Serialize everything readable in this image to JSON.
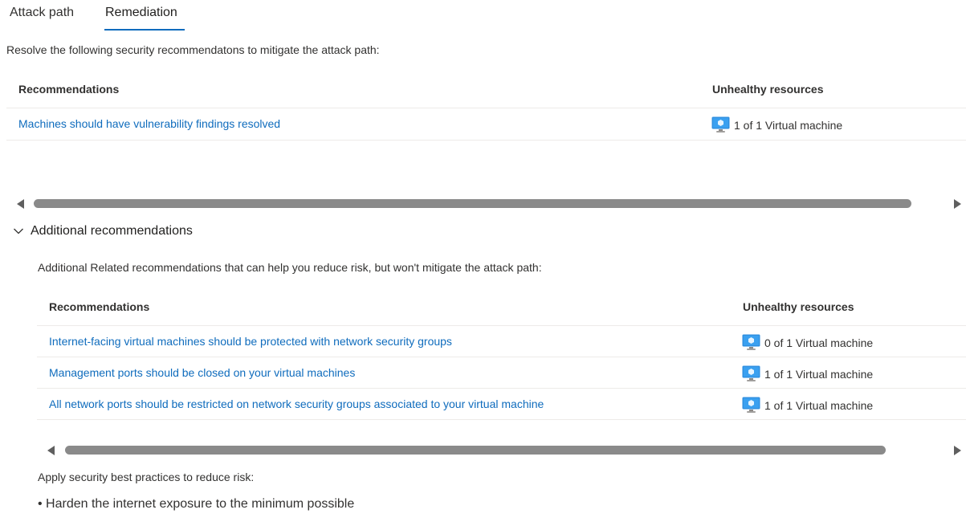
{
  "tabs": [
    {
      "label": "Attack path"
    },
    {
      "label": "Remediation"
    }
  ],
  "intro": "Resolve the following security recommendatons to mitigate the attack path:",
  "main_table": {
    "headers": {
      "recommendations": "Recommendations",
      "unhealthy": "Unhealthy resources"
    },
    "rows": [
      {
        "recommendation": "Machines should have vulnerability findings resolved",
        "unhealthy": "1 of 1 Virtual machine"
      }
    ]
  },
  "additional": {
    "title": "Additional recommendations",
    "intro": "Additional Related recommendations that can help you reduce risk, but won't mitigate the attack path:",
    "table": {
      "headers": {
        "recommendations": "Recommendations",
        "unhealthy": "Unhealthy resources"
      },
      "rows": [
        {
          "recommendation": "Internet-facing virtual machines should be protected with network security groups",
          "unhealthy": "0 of 1 Virtual machine"
        },
        {
          "recommendation": "Management ports should be closed on your virtual machines",
          "unhealthy": "1 of 1 Virtual machine"
        },
        {
          "recommendation": "All network ports should be restricted on network security groups associated to your virtual machine",
          "unhealthy": "1 of 1 Virtual machine"
        }
      ]
    }
  },
  "best_practices": {
    "label": "Apply security best practices to reduce risk:",
    "items": [
      "• Harden the internet exposure to the minimum possible"
    ]
  },
  "colors": {
    "accent": "#0f6cbd",
    "link": "#0f6cbd",
    "text": "#323130"
  },
  "icons": {
    "resource": "virtual-machine-icon",
    "collapse": "chevron-down-icon"
  }
}
